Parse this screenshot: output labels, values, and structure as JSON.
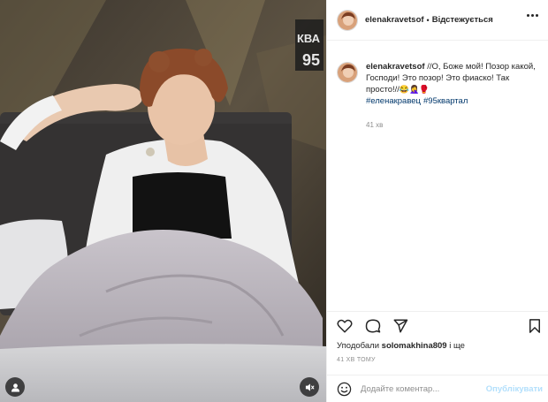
{
  "media": {
    "watermark_line1": "КВА",
    "watermark_line2": "95",
    "user_tag_icon": "user-icon",
    "mute_icon": "speaker-muted-icon"
  },
  "header": {
    "username": "elenakravetsof",
    "dot": "•",
    "follow_label": "Відстежується",
    "more_icon": "ellipsis-icon"
  },
  "caption": {
    "username": "elenakravetsof",
    "text": "//О, Боже мой! Позор какой, Господи! Это позор! Это фиаско! Так просто!//",
    "emojis": "😂🤦‍♀️🥊",
    "hashtags": [
      "#еленакравец",
      "#95квартал"
    ],
    "time": "41 хв"
  },
  "actions": {
    "like_icon": "heart-icon",
    "comment_icon": "comment-icon",
    "share_icon": "send-icon",
    "save_icon": "bookmark-icon"
  },
  "likes": {
    "prefix": "Уподобали",
    "user": "solomakhina809",
    "suffix": "і ще"
  },
  "posted_time": "41 ХВ ТОМУ",
  "comment": {
    "emoji_icon": "smiley-icon",
    "placeholder": "Додайте коментар...",
    "post_label": "Опублікувати"
  },
  "colors": {
    "link": "#00376b",
    "muted": "#8e8e8e",
    "post_disabled": "#b2dffc"
  }
}
